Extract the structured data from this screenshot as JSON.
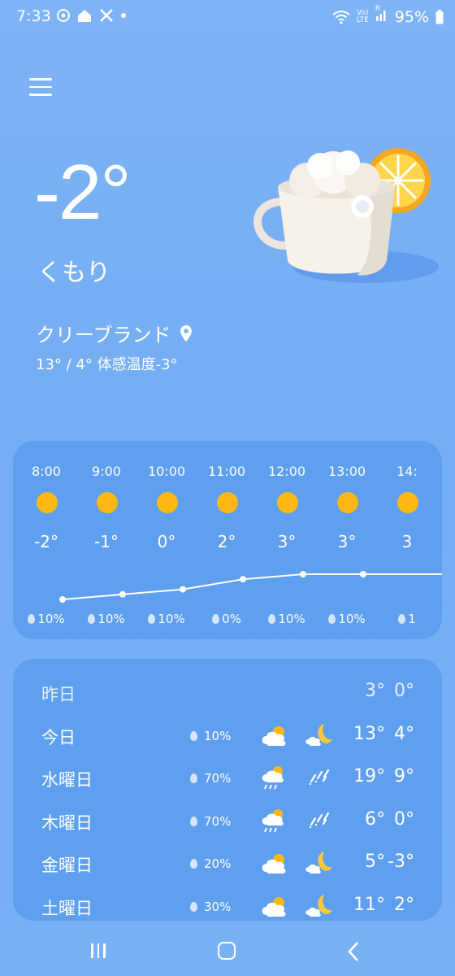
{
  "status_bar": {
    "time": "7:33",
    "battery": "95%",
    "net_top": "Vo)",
    "net_bottom": "LTE",
    "roam": "R"
  },
  "current": {
    "temp": "-2°",
    "condition": "くもり",
    "location": "クリーブランド",
    "hilo_feels": "13° / 4° 体感温度-3°"
  },
  "hourly": [
    {
      "time": "8:00",
      "temp": "-2°",
      "rain": "10%"
    },
    {
      "time": "9:00",
      "temp": "-1°",
      "rain": "10%"
    },
    {
      "time": "10:00",
      "temp": "0°",
      "rain": "10%"
    },
    {
      "time": "11:00",
      "temp": "2°",
      "rain": "0%"
    },
    {
      "time": "12:00",
      "temp": "3°",
      "rain": "10%"
    },
    {
      "time": "13:00",
      "temp": "3°",
      "rain": "10%"
    },
    {
      "time": "14:",
      "temp": "3",
      "rain": "1"
    }
  ],
  "daily": [
    {
      "day": "昨日",
      "pct": "",
      "hi": "3°",
      "lo": "0°"
    },
    {
      "day": "今日",
      "pct": "10%",
      "hi": "13°",
      "lo": "4°",
      "icon_day": "partly-cloudy-icon",
      "icon_night": "moon-cloud-icon"
    },
    {
      "day": "水曜日",
      "pct": "70%",
      "hi": "19°",
      "lo": "9°",
      "icon_day": "rain-cloud-icon",
      "icon_night": "rain-icon"
    },
    {
      "day": "木曜日",
      "pct": "70%",
      "hi": "6°",
      "lo": "0°",
      "icon_day": "rain-cloud-icon",
      "icon_night": "rain-icon"
    },
    {
      "day": "金曜日",
      "pct": "20%",
      "hi": "5°",
      "lo": "-3°",
      "icon_day": "partly-cloudy-icon",
      "icon_night": "moon-cloud-icon"
    },
    {
      "day": "土曜日",
      "pct": "30%",
      "hi": "11°",
      "lo": "2°",
      "icon_day": "partly-cloudy-icon",
      "icon_night": "moon-cloud-icon"
    }
  ],
  "colors": {
    "sun": "#fdb813",
    "card": "#5f9ff0",
    "background": "#7fb3f5"
  }
}
